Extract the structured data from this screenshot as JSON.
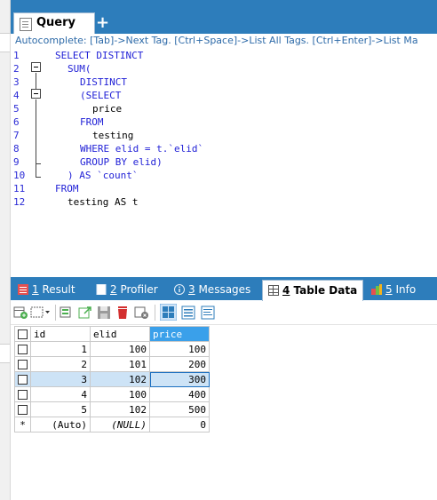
{
  "query_tab": {
    "label": "Query",
    "add_symbol": "+"
  },
  "autocomplete_hint": "Autocomplete: [Tab]->Next Tag. [Ctrl+Space]->List All Tags. [Ctrl+Enter]->List Ma",
  "editor": {
    "line_numbers": [
      "1",
      "2",
      "3",
      "4",
      "5",
      "6",
      "7",
      "8",
      "9",
      "10",
      "11",
      "12"
    ],
    "lines": [
      "SELECT DISTINCT",
      "SUM(",
      "DISTINCT",
      "(SELECT",
      "price",
      "FROM",
      "testing",
      "WHERE elid = t.`elid`",
      "GROUP BY elid)",
      ") AS `count`",
      "FROM",
      "testing AS t"
    ]
  },
  "result_tabs": [
    {
      "num": "1",
      "label": " Result",
      "icon": "result-icon"
    },
    {
      "num": "2",
      "label": " Profiler",
      "icon": "profiler-icon"
    },
    {
      "num": "3",
      "label": " Messages",
      "icon": "info-icon"
    },
    {
      "num": "4",
      "label": " Table Data",
      "icon": "table-data-icon"
    },
    {
      "num": "5",
      "label": " Info",
      "icon": "info-blocks-icon"
    }
  ],
  "toolbar_icons": [
    "insert-row-icon",
    "dropdown-options-icon",
    "duplicate-row-icon",
    "export-icon",
    "save-icon",
    "delete-icon",
    "cancel-icon",
    "grid-view-icon",
    "form-view-icon",
    "text-view-icon"
  ],
  "grid": {
    "columns": [
      "id",
      "elid",
      "price"
    ],
    "rows": [
      [
        "1",
        "100",
        "100"
      ],
      [
        "2",
        "101",
        "200"
      ],
      [
        "3",
        "102",
        "300"
      ],
      [
        "4",
        "100",
        "400"
      ],
      [
        "5",
        "102",
        "500"
      ]
    ],
    "new_row": {
      "marker": "*",
      "id": "(Auto)",
      "elid": "(NULL)",
      "price": "0"
    }
  },
  "colors": {
    "tab_bar": "#2d7dbb",
    "keyword": "#1f1fd6",
    "selected_header": "#3aa0ea",
    "highlight_row": "#cde3f6"
  }
}
